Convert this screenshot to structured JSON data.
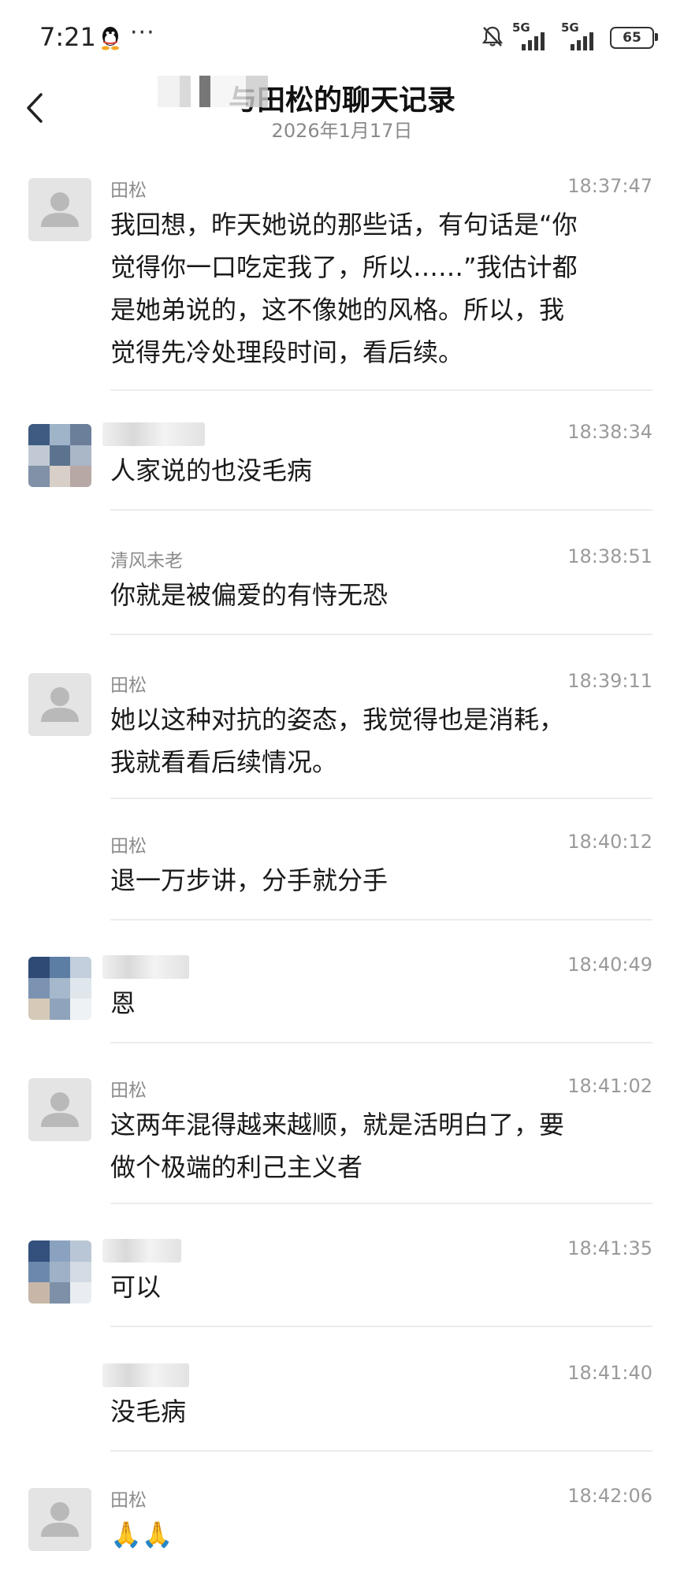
{
  "status_bar": {
    "time": "7:21",
    "network_1": "5G",
    "network_2": "5G",
    "battery": "65",
    "icons": [
      "qq-icon",
      "more-icon",
      "bell-muted-icon",
      "signal-icon",
      "signal-icon",
      "battery-icon"
    ]
  },
  "header": {
    "title": "与田松的聊天记录",
    "date": "2026年1月17日",
    "back_icon": "chevron-left-icon"
  },
  "messages": [
    {
      "sender": "田松",
      "time": "18:37:47",
      "lines": [
        "我回想，昨天她说的那些话，有句话是“你",
        "觉得你一口吃定我了，所以……”我估计都",
        "是她弟说的，这不像她的风格。所以，我",
        "觉得先冷处理段时间，看后续。"
      ]
    },
    {
      "sender": "",
      "time": "18:38:34",
      "lines": [
        "人家说的也没毛病"
      ]
    },
    {
      "sender": "清风未老",
      "time": "18:38:51",
      "lines": [
        "你就是被偏爱的有恃无恐"
      ]
    },
    {
      "sender": "田松",
      "time": "18:39:11",
      "lines": [
        "她以这种对抗的姿态，我觉得也是消耗，",
        "我就看看后续情况。"
      ]
    },
    {
      "sender": "田松",
      "time": "18:40:12",
      "lines": [
        "退一万步讲，分手就分手"
      ]
    },
    {
      "sender": "",
      "time": "18:40:49",
      "lines": [
        "恩"
      ]
    },
    {
      "sender": "田松",
      "time": "18:41:02",
      "lines": [
        "这两年混得越来越顺，就是活明白了，要",
        "做个极端的利己主义者"
      ]
    },
    {
      "sender": "",
      "time": "18:41:35",
      "lines": [
        "可以"
      ]
    },
    {
      "sender": "",
      "time": "18:41:40",
      "lines": [
        "没毛病"
      ]
    },
    {
      "sender": "田松",
      "time": "18:42:06",
      "lines": [
        "🙏🙏"
      ]
    }
  ],
  "colors": {
    "background": "#ffffff",
    "meta_text": "#8c8c8c",
    "divider": "#ececec",
    "avatar_placeholder": "#e6e6e6"
  }
}
